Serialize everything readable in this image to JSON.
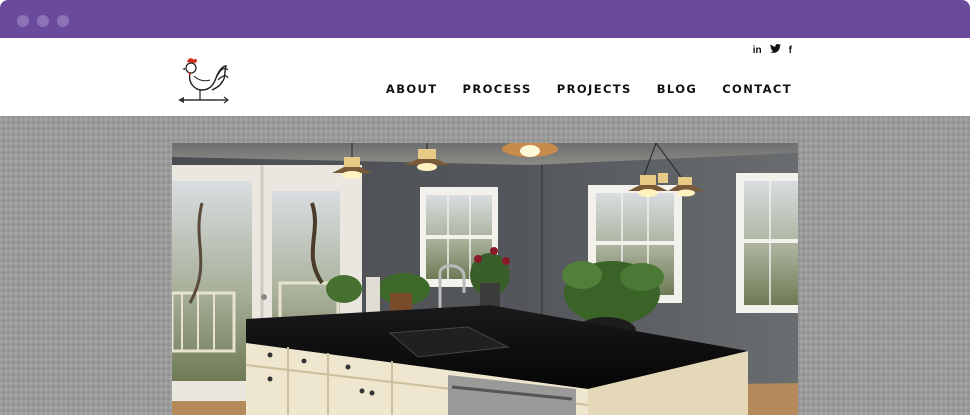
{
  "browser": {
    "accent_color": "#6a4a9c",
    "window_controls": [
      "window-dot",
      "window-dot",
      "window-dot"
    ]
  },
  "header": {
    "logo_icon": "rooster-weathervane-icon",
    "social": [
      {
        "label": "in",
        "icon": "linkedin-icon"
      },
      {
        "label": "🐦",
        "icon": "twitter-icon"
      },
      {
        "label": "f",
        "icon": "facebook-icon"
      }
    ],
    "nav": [
      "ABOUT",
      "PROCESS",
      "PROJECTS",
      "BLOG",
      "CONTACT"
    ]
  },
  "hero": {
    "background_color": "#9c9c9c",
    "image": "kitchen-interior-photo"
  }
}
